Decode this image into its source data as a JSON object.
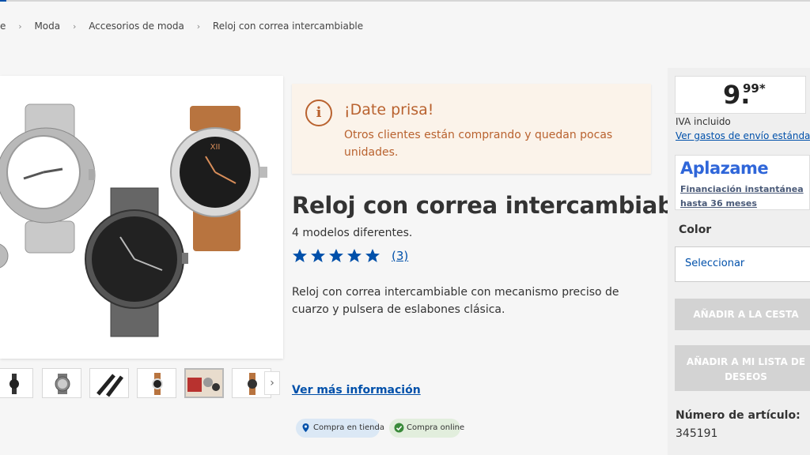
{
  "breadcrumb": {
    "home_partial": "e",
    "items": [
      "Moda",
      "Accesorios de moda",
      "Reloj con correa intercambiable"
    ]
  },
  "alert": {
    "icon": "info-icon",
    "icon_glyph": "i",
    "title": "¡Date prisa!",
    "message": "Otros clientes están comprando y quedan pocas unidades."
  },
  "product": {
    "title": "Reloj con correa intercambiable",
    "subtitle": "4 modelos diferentes.",
    "rating_stars": 5,
    "rating_count": "(3)",
    "description": "Reloj con correa intercambiable con mecanismo preciso de cuarzo y pulsera de eslabones clásica.",
    "more_info": "Ver más información",
    "availability": [
      "Compra en tienda",
      "Compra online"
    ]
  },
  "price": {
    "integer": "9.",
    "decimals": "99*",
    "vat": "IVA incluido",
    "shipping_link": "Ver gastos de envío estándar"
  },
  "financing": {
    "brand": "Aplazame",
    "link": "Financiación instantánea hasta 36 meses"
  },
  "options": {
    "color_label": "Color",
    "color_placeholder": "Seleccionar"
  },
  "actions": {
    "add_to_cart": "AÑADIR A LA CESTA",
    "add_to_wishlist": "AÑADIR A MI LISTA DE DESEOS"
  },
  "article": {
    "label": "Número de artículo:",
    "number": "345191"
  },
  "colors": {
    "accent": "#0050aa",
    "alert_text": "#b9622f",
    "alert_bg": "#fbf3ea",
    "star": "#0050aa",
    "disabled": "#d3d3d3",
    "aplazame": "#2f66d9"
  }
}
